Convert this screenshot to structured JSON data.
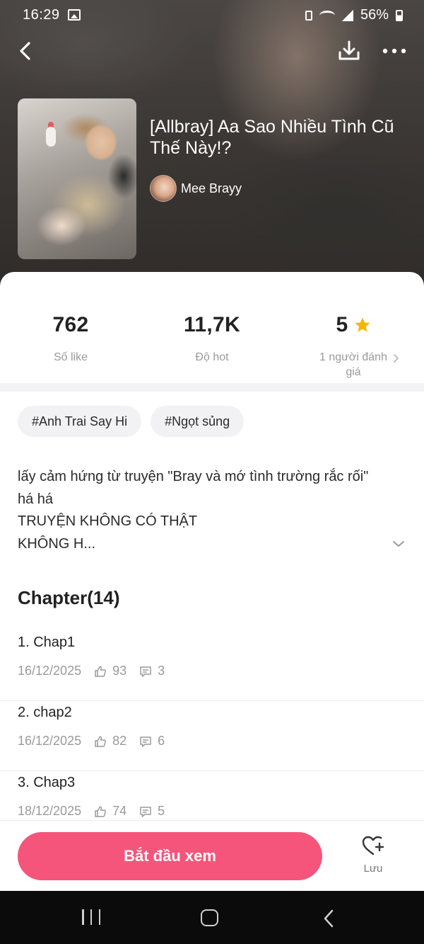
{
  "status_bar": {
    "time": "16:29",
    "battery": "56%"
  },
  "icons": {
    "back": "chevron-left-icon",
    "download": "download-icon",
    "more": "more-horizontal-icon",
    "star": "star-icon",
    "like": "thumbs-up-icon",
    "comment": "comment-icon",
    "save": "heart-plus-icon",
    "expand": "chevron-down-icon"
  },
  "story": {
    "title": "[Allbray] Aa Sao Nhiều Tình Cũ Thế Này!?",
    "author": "Mee Brayy"
  },
  "stats": {
    "likes": {
      "value": "762",
      "label": "Số like"
    },
    "hot": {
      "value": "11,7K",
      "label": "Độ hot"
    },
    "rating": {
      "value": "5",
      "label": "1 người đánh giá"
    }
  },
  "tags": [
    "#Anh Trai Say Hi",
    "#Ngọt sủng"
  ],
  "description": {
    "lines": [
      "lấy cảm hứng từ truyện \"Bray và mớ tình trường rắc rối\"",
      "há há",
      "TRUYỆN KHÔNG CÓ THẬT",
      "KHÔNG H..."
    ]
  },
  "chapters": {
    "heading": "Chapter(14)",
    "items": [
      {
        "name": "1. Chap1",
        "date": "16/12/2025",
        "likes": "93",
        "comments": "3"
      },
      {
        "name": "2. chap2",
        "date": "16/12/2025",
        "likes": "82",
        "comments": "6"
      },
      {
        "name": "3. Chap3",
        "date": "18/12/2025",
        "likes": "74",
        "comments": "5"
      }
    ]
  },
  "actions": {
    "start_label": "Bắt đầu xem",
    "save_label": "Lưu"
  },
  "colors": {
    "accent": "#f5557a",
    "star": "#f7b500"
  }
}
